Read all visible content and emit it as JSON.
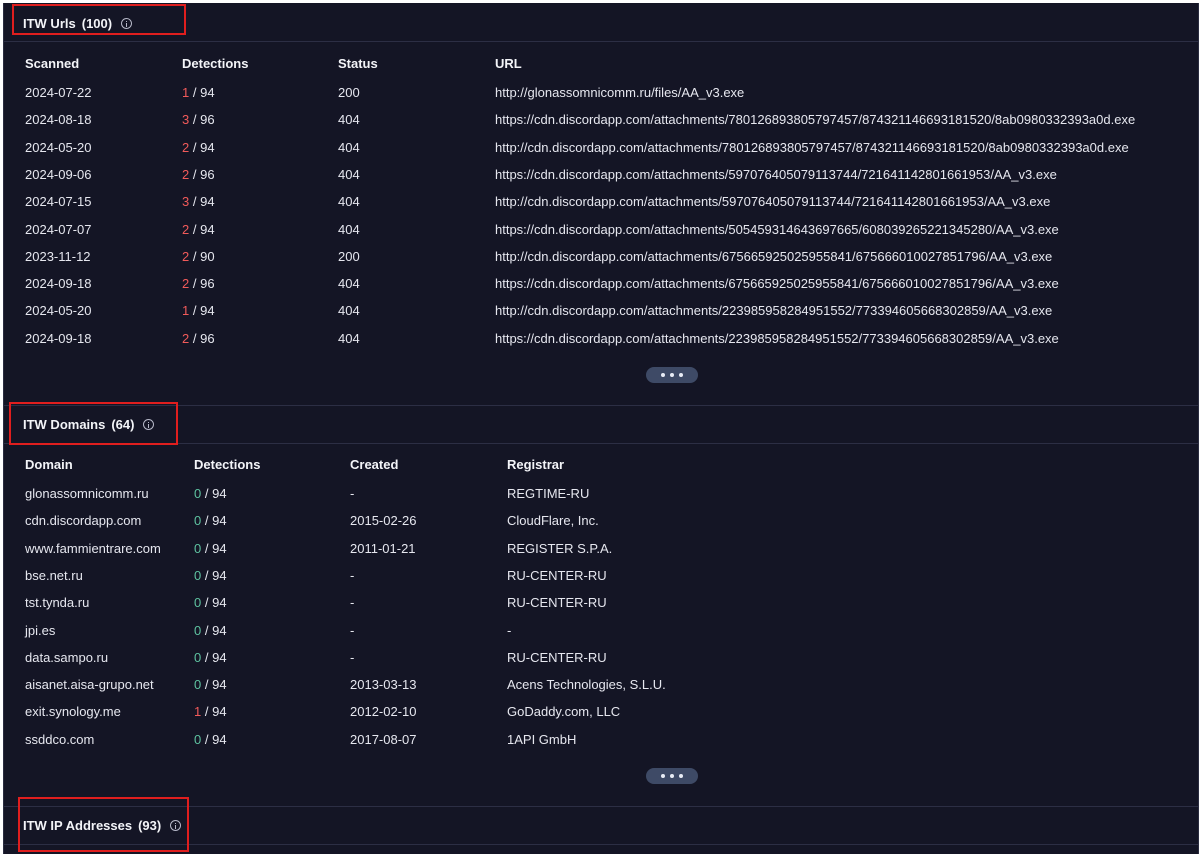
{
  "urls_section": {
    "title": "ITW Urls",
    "count": "(100)",
    "columns": [
      "Scanned",
      "Detections",
      "Status",
      "URL"
    ],
    "rows": [
      {
        "scanned": "2024-07-22",
        "det": "1",
        "total": "/ 94",
        "status": "200",
        "url": "http://glonassomnicomm.ru/files/AA_v3.exe"
      },
      {
        "scanned": "2024-08-18",
        "det": "3",
        "total": "/ 96",
        "status": "404",
        "url": "https://cdn.discordapp.com/attachments/780126893805797457/874321146693181520/8ab0980332393a0d.exe"
      },
      {
        "scanned": "2024-05-20",
        "det": "2",
        "total": "/ 94",
        "status": "404",
        "url": "http://cdn.discordapp.com/attachments/780126893805797457/874321146693181520/8ab0980332393a0d.exe"
      },
      {
        "scanned": "2024-09-06",
        "det": "2",
        "total": "/ 96",
        "status": "404",
        "url": "https://cdn.discordapp.com/attachments/597076405079113744/721641142801661953/AA_v3.exe"
      },
      {
        "scanned": "2024-07-15",
        "det": "3",
        "total": "/ 94",
        "status": "404",
        "url": "http://cdn.discordapp.com/attachments/597076405079113744/721641142801661953/AA_v3.exe"
      },
      {
        "scanned": "2024-07-07",
        "det": "2",
        "total": "/ 94",
        "status": "404",
        "url": "https://cdn.discordapp.com/attachments/505459314643697665/608039265221345280/AA_v3.exe"
      },
      {
        "scanned": "2023-11-12",
        "det": "2",
        "total": "/ 90",
        "status": "200",
        "url": "http://cdn.discordapp.com/attachments/675665925025955841/675666010027851796/AA_v3.exe"
      },
      {
        "scanned": "2024-09-18",
        "det": "2",
        "total": "/ 96",
        "status": "404",
        "url": "https://cdn.discordapp.com/attachments/675665925025955841/675666010027851796/AA_v3.exe"
      },
      {
        "scanned": "2024-05-20",
        "det": "1",
        "total": "/ 94",
        "status": "404",
        "url": "http://cdn.discordapp.com/attachments/223985958284951552/773394605668302859/AA_v3.exe"
      },
      {
        "scanned": "2024-09-18",
        "det": "2",
        "total": "/ 96",
        "status": "404",
        "url": "https://cdn.discordapp.com/attachments/223985958284951552/773394605668302859/AA_v3.exe"
      }
    ]
  },
  "domains_section": {
    "title": "ITW Domains",
    "count": "(64)",
    "columns": [
      "Domain",
      "Detections",
      "Created",
      "Registrar"
    ],
    "rows": [
      {
        "domain": "glonassomnicomm.ru",
        "det": "0",
        "total": "/ 94",
        "created": "-",
        "registrar": "REGTIME-RU"
      },
      {
        "domain": "cdn.discordapp.com",
        "det": "0",
        "total": "/ 94",
        "created": "2015-02-26",
        "registrar": "CloudFlare, Inc."
      },
      {
        "domain": "www.fammientrare.com",
        "det": "0",
        "total": "/ 94",
        "created": "2011-01-21",
        "registrar": "REGISTER S.P.A."
      },
      {
        "domain": "bse.net.ru",
        "det": "0",
        "total": "/ 94",
        "created": "-",
        "registrar": "RU-CENTER-RU"
      },
      {
        "domain": "tst.tynda.ru",
        "det": "0",
        "total": "/ 94",
        "created": "-",
        "registrar": "RU-CENTER-RU"
      },
      {
        "domain": "jpi.es",
        "det": "0",
        "total": "/ 94",
        "created": "-",
        "registrar": "-"
      },
      {
        "domain": "data.sampo.ru",
        "det": "0",
        "total": "/ 94",
        "created": "-",
        "registrar": "RU-CENTER-RU"
      },
      {
        "domain": "aisanet.aisa-grupo.net",
        "det": "0",
        "total": "/ 94",
        "created": "2013-03-13",
        "registrar": "Acens Technologies, S.L.U."
      },
      {
        "domain": "exit.synology.me",
        "det": "1",
        "total": "/ 94",
        "created": "2012-02-10",
        "registrar": "GoDaddy.com, LLC"
      },
      {
        "domain": "ssddco.com",
        "det": "0",
        "total": "/ 94",
        "created": "2017-08-07",
        "registrar": "1API GmbH"
      }
    ]
  },
  "ip_section": {
    "title": "ITW IP Addresses",
    "count": "(93)"
  },
  "colors": {
    "background": "#141525",
    "detection_positive": "#f15a5a",
    "detection_zero": "#5ec2a0",
    "highlight_box": "#e01e1e",
    "more_button": "#3e4a66"
  },
  "icons": {
    "info": "info-circle-icon",
    "more": "ellipsis-icon"
  }
}
